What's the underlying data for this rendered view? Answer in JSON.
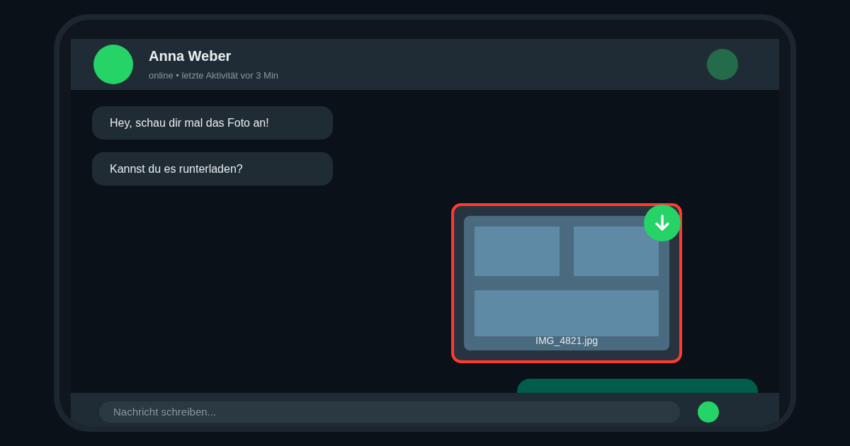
{
  "contact": {
    "name": "Anna Weber",
    "status": "online • letzte Aktivität vor 3 Min"
  },
  "messages": [
    {
      "kind": "text",
      "outgoing": false,
      "text": "Hey, schau dir mal das Foto an!"
    },
    {
      "kind": "text",
      "outgoing": false,
      "text": "Kannst du es runterladen?"
    },
    {
      "outgoing": true,
      "filename": "IMG_4821.jpg",
      "highlighted": true
    },
    {
      "kind": "bubble",
      "outgoing": true
    }
  ],
  "composer": {
    "placeholder": "Nachricht schreiben..."
  }
}
